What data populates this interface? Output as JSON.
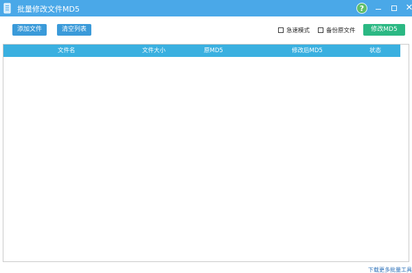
{
  "window": {
    "title": "批量修改文件MD5",
    "help_glyph": "?",
    "close_glyph": "✕"
  },
  "toolbar": {
    "add_file_label": "添加文件",
    "clear_list_label": "清空列表",
    "fast_mode_label": "急速模式",
    "fast_mode_checked": false,
    "backup_label": "备份原文件",
    "backup_checked": false,
    "modify_label": "修改MD5"
  },
  "table": {
    "columns": [
      "文件名",
      "文件大小",
      "原MD5",
      "修改后MD5",
      "状态"
    ],
    "rows": []
  },
  "footer": {
    "link_text": "下载更多批量工具"
  },
  "colors": {
    "titlebar": "#4aa8e8",
    "header": "#3ab0e0",
    "button_blue": "#3a9ad9",
    "button_green": "#2bb883"
  }
}
